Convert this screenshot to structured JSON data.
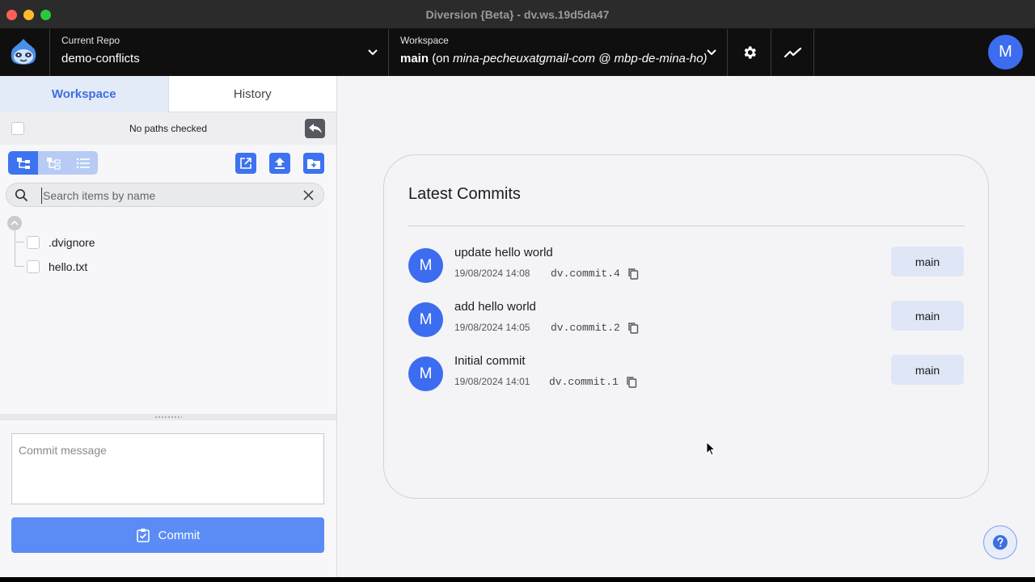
{
  "window": {
    "title": "Diversion {Beta} - dv.ws.19d5da47"
  },
  "header": {
    "repo_label": "Current Repo",
    "repo_name": "demo-conflicts",
    "workspace_label": "Workspace",
    "workspace_branch": "main",
    "workspace_on": "(on",
    "workspace_user_host": "mina-pecheuxatgmail-com @ mbp-de-mina-ho)",
    "avatar_initial": "M",
    "icons": [
      "logo-sloth-icon",
      "chevron-down-icon",
      "gear-icon",
      "trend-chart-icon"
    ]
  },
  "left_panel": {
    "tabs": [
      {
        "label": "Workspace",
        "active": true
      },
      {
        "label": "History",
        "active": false
      }
    ],
    "paths_status": "No paths checked",
    "search_placeholder": "Search items by name",
    "files": [
      {
        "name": ".dvignore",
        "checked": false
      },
      {
        "name": "hello.txt",
        "checked": false
      }
    ],
    "commit_placeholder": "Commit message",
    "commit_button": "Commit"
  },
  "latest_commits": {
    "title": "Latest Commits",
    "commits": [
      {
        "avatar": "M",
        "message": "update hello world",
        "date": "19/08/2024 14:08",
        "id": "dv.commit.4",
        "branch": "main"
      },
      {
        "avatar": "M",
        "message": "add hello world",
        "date": "19/08/2024 14:05",
        "id": "dv.commit.2",
        "branch": "main"
      },
      {
        "avatar": "M",
        "message": "Initial commit",
        "date": "19/08/2024 14:01",
        "id": "dv.commit.1",
        "branch": "main"
      }
    ]
  },
  "colors": {
    "accent": "#3d73f0",
    "avatar": "#3c6cf0",
    "header_bg": "#0f0f10",
    "badge_bg": "#dfe6f6"
  }
}
